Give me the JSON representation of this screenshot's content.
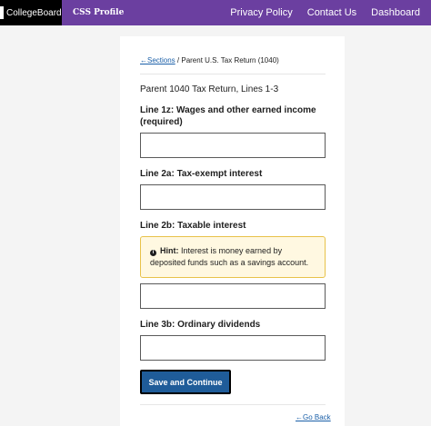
{
  "header": {
    "brand": "CollegeBoard",
    "product": "CSS Profile",
    "nav": [
      "Privacy Policy",
      "Contact Us",
      "Dashboard"
    ]
  },
  "breadcrumb": {
    "link": "←Sections",
    "separator": " / ",
    "current": "Parent U.S. Tax Return (1040)"
  },
  "form": {
    "section_title": "Parent 1040 Tax Return, Lines 1-3",
    "fields": [
      {
        "label": "Line 1z: Wages and other earned income (required)",
        "value": ""
      },
      {
        "label": "Line 2a: Tax-exempt interest",
        "value": ""
      },
      {
        "label": "Line 2b: Taxable interest",
        "value": ""
      },
      {
        "label": "Line 3b: Ordinary dividends",
        "value": ""
      }
    ],
    "hint": {
      "icon": "info-icon",
      "label": "Hint:",
      "text": "Interest is money earned by deposited funds such as a savings account."
    },
    "save_label": "Save and Continue",
    "back_label": "←Go Back"
  }
}
